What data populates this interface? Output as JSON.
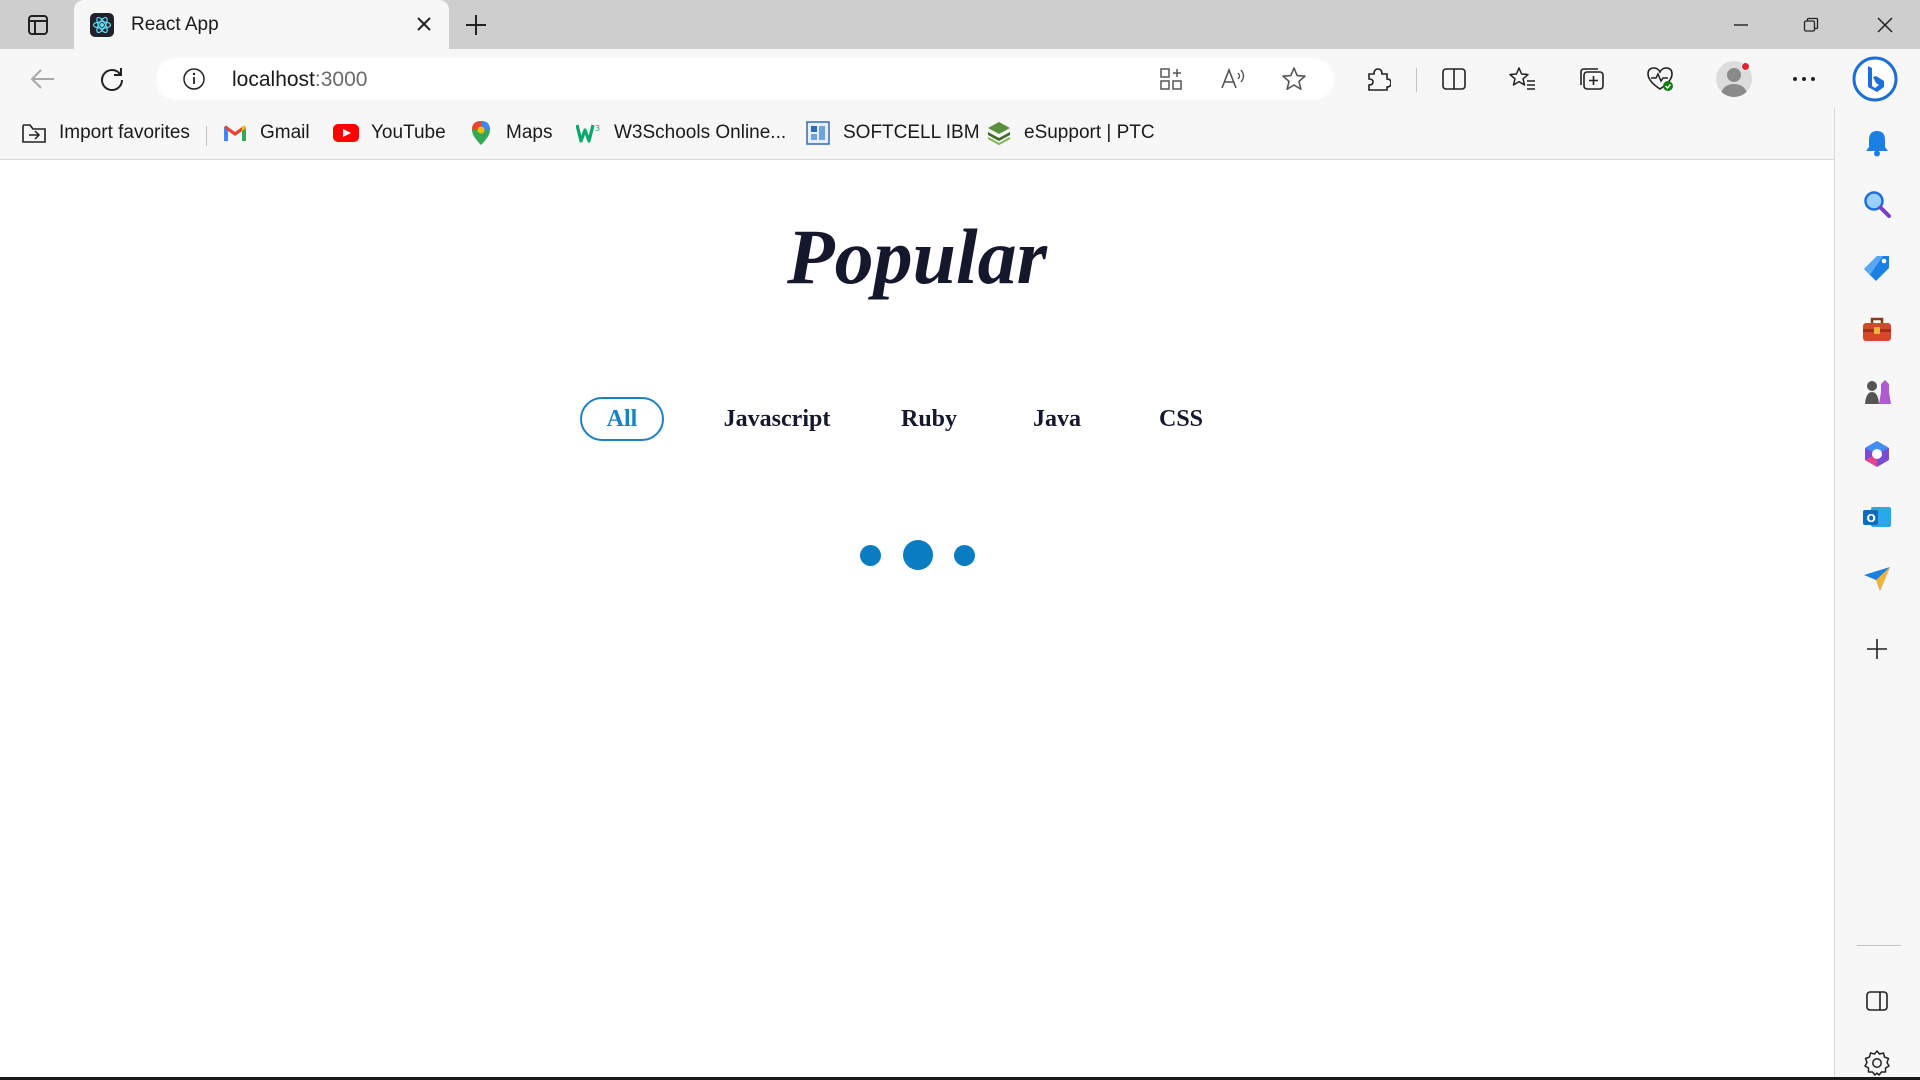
{
  "browser": {
    "tab": {
      "title": "React App",
      "favicon": "react-logo-icon"
    },
    "address_bar": {
      "host": "localhost",
      "port": ":3000"
    },
    "window_controls": [
      "minimize-icon",
      "restore-icon",
      "close-icon"
    ],
    "favorites": [
      {
        "label": "Import favorites",
        "icon": "import-favorites-icon"
      },
      {
        "label": "Gmail",
        "icon": "gmail-icon"
      },
      {
        "label": "YouTube",
        "icon": "youtube-icon"
      },
      {
        "label": "Maps",
        "icon": "maps-pin-icon"
      },
      {
        "label": "W3Schools Online...",
        "icon": "w3schools-icon"
      },
      {
        "label": "SOFTCELL IBM",
        "icon": "softcell-icon"
      },
      {
        "label": "eSupport | PTC",
        "icon": "ptc-icon"
      }
    ],
    "sidebar_icons": [
      "bell-icon",
      "search-icon",
      "shopping-tag-icon",
      "toolbox-icon",
      "games-icon",
      "office-icon",
      "outlook-icon",
      "send-icon",
      "add-icon",
      "sidebar-toggle-icon",
      "settings-icon"
    ]
  },
  "page": {
    "title": "Popular",
    "filters": [
      "All",
      "Javascript",
      "Ruby",
      "Java",
      "CSS"
    ],
    "active_filter": "All",
    "loading_dots": 3
  },
  "colors": {
    "accent": "#1b80c4",
    "loader": "#0a7cc1",
    "title_text": "#15172c",
    "chrome_bg": "#f7f7f7",
    "tabstrip_bg": "#cecece"
  }
}
